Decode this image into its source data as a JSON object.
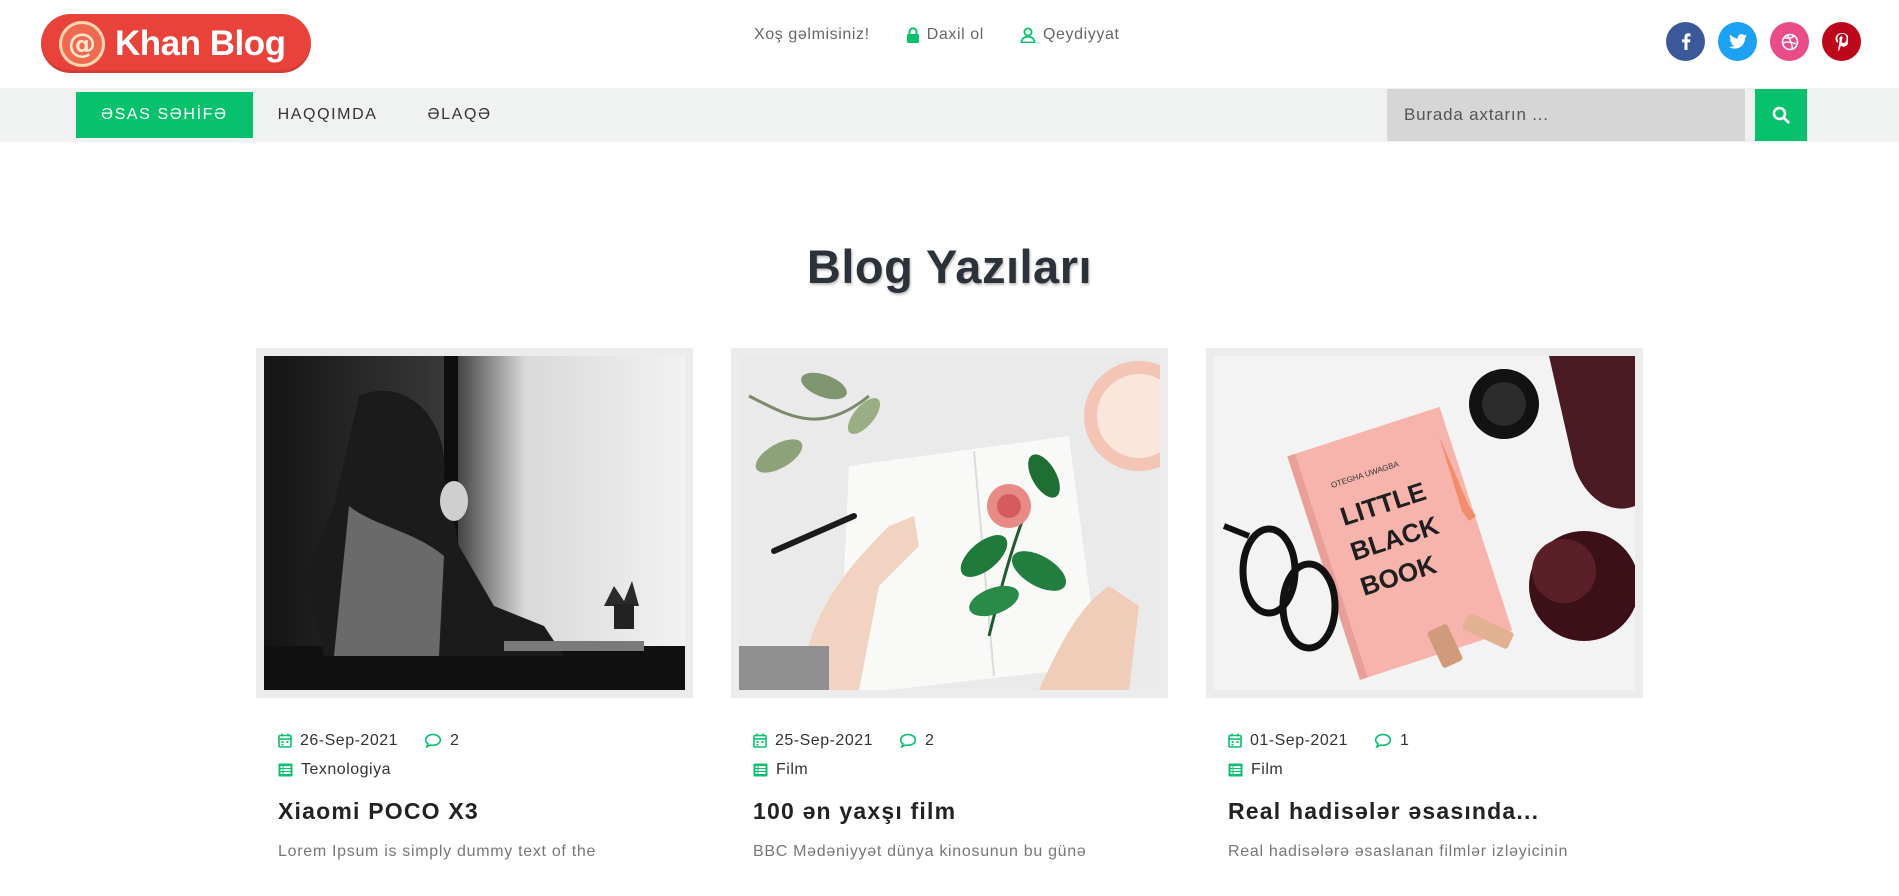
{
  "brand": {
    "name": "Khan Blog",
    "mark": "@",
    "color": "#e8423b"
  },
  "header": {
    "welcome": "Xoş gəlmisiniz!",
    "login": "Daxil ol",
    "register": "Qeydiyyat",
    "socials": [
      {
        "name": "facebook-icon",
        "color": "#3b5998"
      },
      {
        "name": "twitter-icon",
        "color": "#1da1f2"
      },
      {
        "name": "dribbble-icon",
        "color": "#ea4c89"
      },
      {
        "name": "pinterest-icon",
        "color": "#bd081c"
      }
    ]
  },
  "nav": {
    "items": [
      {
        "label": "ƏSAS SƏHİFƏ",
        "active": true
      },
      {
        "label": "HAQQIMDA",
        "active": false
      },
      {
        "label": "ƏLAQƏ",
        "active": false
      }
    ],
    "search_placeholder": "Burada axtarın ...",
    "accent": "#08c16d"
  },
  "main": {
    "title": "Blog Yazıları",
    "posts": [
      {
        "date": "26-Sep-2021",
        "comments": "2",
        "category": "Texnologiya",
        "title": "Xiaomi POCO X3",
        "excerpt": "Lorem Ipsum is simply dummy text of the",
        "image": "woman-laptop-photo"
      },
      {
        "date": "25-Sep-2021",
        "comments": "2",
        "category": "Film",
        "title": "100 ən yaxşı film",
        "excerpt": "BBC Mədəniyyət dünya kinosunun bu günə",
        "image": "flower-drawing-photo"
      },
      {
        "date": "01-Sep-2021",
        "comments": "1",
        "category": "Film",
        "title": "Real hadisələr əsasında...",
        "excerpt": "Real hadisələrə əsaslanan filmlər izləyicinin",
        "image": "little-black-book-photo"
      }
    ]
  }
}
